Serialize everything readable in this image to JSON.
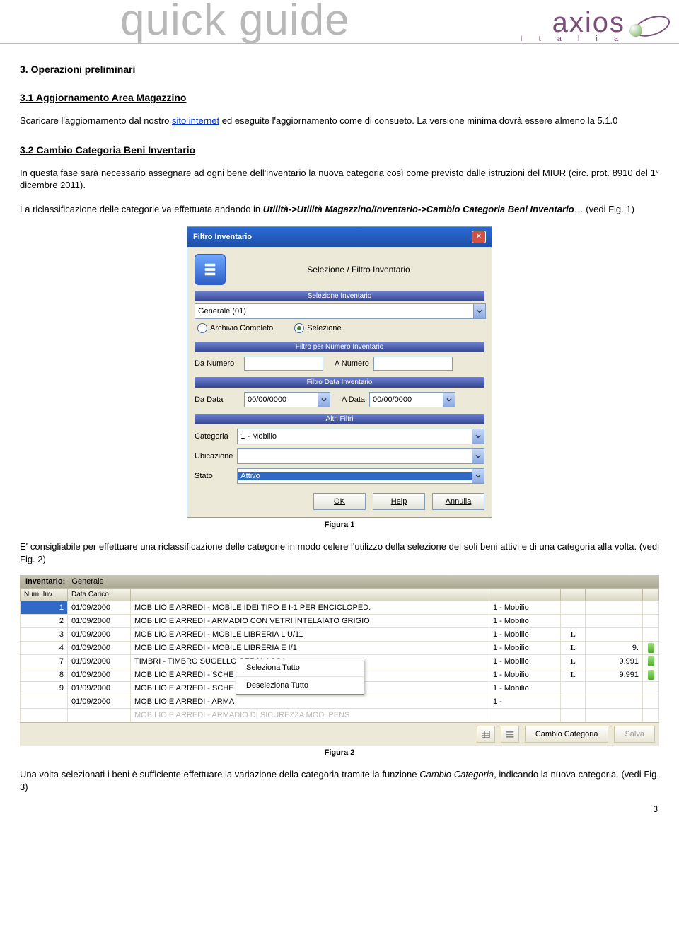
{
  "header": {
    "banner": "quick guide",
    "brand": "axios",
    "brand_sub": "I t a l i a"
  },
  "s3": {
    "title": "3. Operazioni preliminari"
  },
  "s31": {
    "title": "3.1 Aggiornamento Area Magazzino",
    "p1a": "Scaricare l'aggiornamento dal nostro ",
    "link": "sito internet",
    "p1b": " ed eseguite l'aggiornamento come di consueto. La versione minima dovrà essere almeno la 5.1.0"
  },
  "s32": {
    "title": "3.2 Cambio Categoria Beni Inventario",
    "p1": "In questa fase sarà necessario assegnare ad ogni bene dell'inventario la nuova categoria così come previsto dalle istruzioni del MIUR (circ. prot. 8910 del 1° dicembre 2011).",
    "p2a": "La riclassificazione delle categorie va effettuata andando in ",
    "p2path": "Utilità->Utilità Magazzino/Inventario->Cambio Categoria Beni Inventario",
    "p2b": "… (vedi Fig. 1)"
  },
  "dialog": {
    "title": "Filtro Inventario",
    "sel_label": "Selezione / Filtro Inventario",
    "band_sel": "Selezione Inventario",
    "combo_inv": "Generale (01)",
    "radio_full": "Archivio Completo",
    "radio_sel": "Selezione",
    "band_num": "Filtro per Numero Inventario",
    "da_numero": "Da Numero",
    "a_numero": "A Numero",
    "band_date": "Filtro Data Inventario",
    "da_data": "Da Data",
    "a_data": "A Data",
    "date_zero": "00/00/0000",
    "band_altri": "Altri Filtri",
    "categoria_lbl": "Categoria",
    "categoria_val": "1 - Mobilio",
    "ubicazione_lbl": "Ubicazione",
    "stato_lbl": "Stato",
    "stato_val": "Attivo",
    "btn_ok": "OK",
    "btn_help": "Help",
    "btn_cancel": "Annulla"
  },
  "fig1_caption": "Figura 1",
  "after_fig1": "E' consigliabile per effettuare una riclassificazione delle categorie in modo celere l'utilizzo della selezione dei soli beni attivi e di una categoria alla volta. (vedi Fig. 2)",
  "grid": {
    "inv_title_label": "Inventario:",
    "inv_title_value": "Generale",
    "headers": {
      "num": "Num. Inv.",
      "data": "Data Carico",
      "l": "",
      "val": ""
    },
    "rows": [
      {
        "n": "1",
        "d": "01/09/2000",
        "desc": "MOBILIO E ARREDI - MOBILE IDEI TIPO E I-1 PER ENCICLOPED.",
        "cat": "1 - Mobilio",
        "L": "",
        "val": ""
      },
      {
        "n": "2",
        "d": "01/09/2000",
        "desc": "MOBILIO E ARREDI - ARMADIO CON VETRI INTELAIATO GRIGIO",
        "cat": "1 - Mobilio",
        "L": "",
        "val": ""
      },
      {
        "n": "3",
        "d": "01/09/2000",
        "desc": "MOBILIO E ARREDI - MOBILE LIBRERIA L U/11",
        "cat": "1 - Mobilio",
        "L": "L",
        "val": ""
      },
      {
        "n": "4",
        "d": "01/09/2000",
        "desc": "MOBILIO E ARREDI - MOBILE LIBRERIA E I/1",
        "cat": "1 - Mobilio",
        "L": "L",
        "val": "9."
      },
      {
        "n": "7",
        "d": "01/09/2000",
        "desc": "TIMBRI - TIMBRO SUGELLO CERALACCA",
        "cat": "1 - Mobilio",
        "L": "L",
        "val": "9.991"
      },
      {
        "n": "8",
        "d": "01/09/2000",
        "desc": "MOBILIO E ARREDI - SCHE",
        "cat": "1 - Mobilio",
        "L": "L",
        "val": "9.991"
      },
      {
        "n": "9",
        "d": "01/09/2000",
        "desc": "MOBILIO E ARREDI - SCHE",
        "cat": "1 - Mobilio",
        "L": "",
        "val": ""
      },
      {
        "n": "",
        "d": "01/09/2000",
        "desc": "MOBILIO E ARREDI - ARMA",
        "cat": "1 -",
        "L": "",
        "val": ""
      }
    ],
    "dim_row_desc": "MOBILIO E ARREDI - ARMADIO DI SICUREZZA MOD. PENS",
    "ctx_sel_all": "Seleziona Tutto",
    "ctx_desel_all": "Deseleziona Tutto",
    "btn_cambio": "Cambio Categoria",
    "btn_salva": "Salva"
  },
  "fig2_caption": "Figura 2",
  "after_fig2_a": "Una volta selezionati i beni è sufficiente effettuare la variazione della categoria tramite la funzione ",
  "after_fig2_path": "Cambio Categoria",
  "after_fig2_b": ", indicando la nuova categoria. (vedi Fig. 3)",
  "page_number": "3"
}
